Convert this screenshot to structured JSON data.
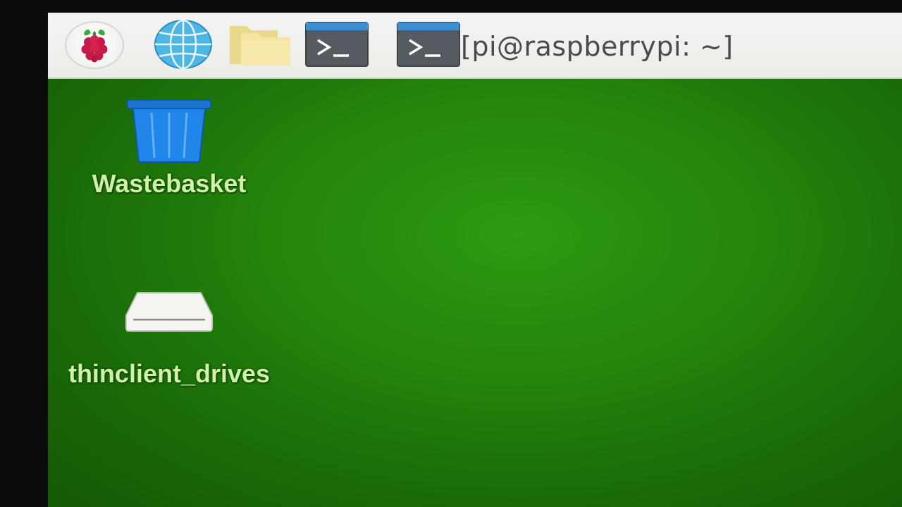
{
  "taskbar": {
    "menu_icon": "raspberry-icon",
    "browser_icon": "globe-icon",
    "files_icon": "folder-icon",
    "terminal_icon": "terminal-icon",
    "window_button_title": "[pi@raspberrypi: ~]"
  },
  "desktop": {
    "icons": [
      {
        "label": "Wastebasket",
        "icon": "trash-icon"
      },
      {
        "label": "thinclient_drives",
        "icon": "drive-icon"
      }
    ]
  },
  "colors": {
    "desktop_green": "#24860c",
    "taskbar_bg": "#f0f0ee",
    "label_color": "#cff2a6",
    "trash_blue": "#1e7fe0"
  }
}
